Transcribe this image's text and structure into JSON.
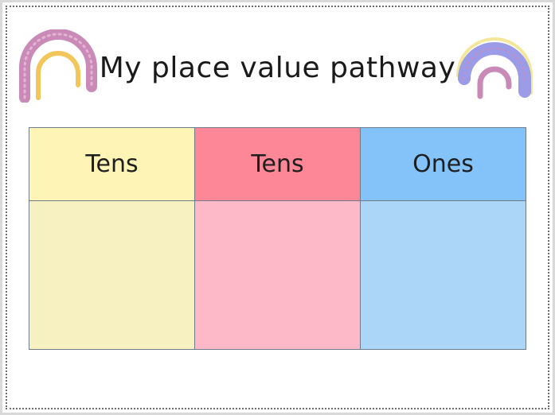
{
  "title": "My place value pathway",
  "columns": [
    {
      "label": "Tens",
      "header_color": "#fdf4b5",
      "body_color": "#f7f0c1"
    },
    {
      "label": "Tens",
      "header_color": "#fd8797",
      "body_color": "#feb9c8"
    },
    {
      "label": "Ones",
      "header_color": "#84c3fa",
      "body_color": "#acd6f8"
    }
  ],
  "decorations": {
    "left": "rainbow-pink-yellow-icon",
    "right": "rainbow-purple-lavender-icon"
  }
}
